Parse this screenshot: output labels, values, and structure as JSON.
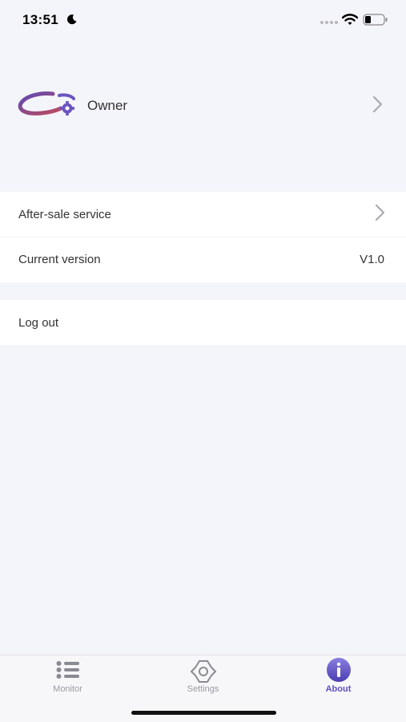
{
  "status_bar": {
    "time": "13:51",
    "icons": [
      "moon-icon",
      "signal-icon",
      "wifi-icon",
      "battery-icon"
    ]
  },
  "profile": {
    "name": "Owner",
    "logo": "brand-logo"
  },
  "menu": {
    "after_sale": "After-sale service",
    "current_version_label": "Current version",
    "current_version_value": "V1.0",
    "logout": "Log out"
  },
  "tabs": {
    "monitor": "Monitor",
    "settings": "Settings",
    "about": "About",
    "active": "About"
  },
  "colors": {
    "accent": "#5b4fc2",
    "background": "#f4f5fa",
    "brand_gradient": [
      "#5c4ab8",
      "#c04a5a"
    ]
  }
}
